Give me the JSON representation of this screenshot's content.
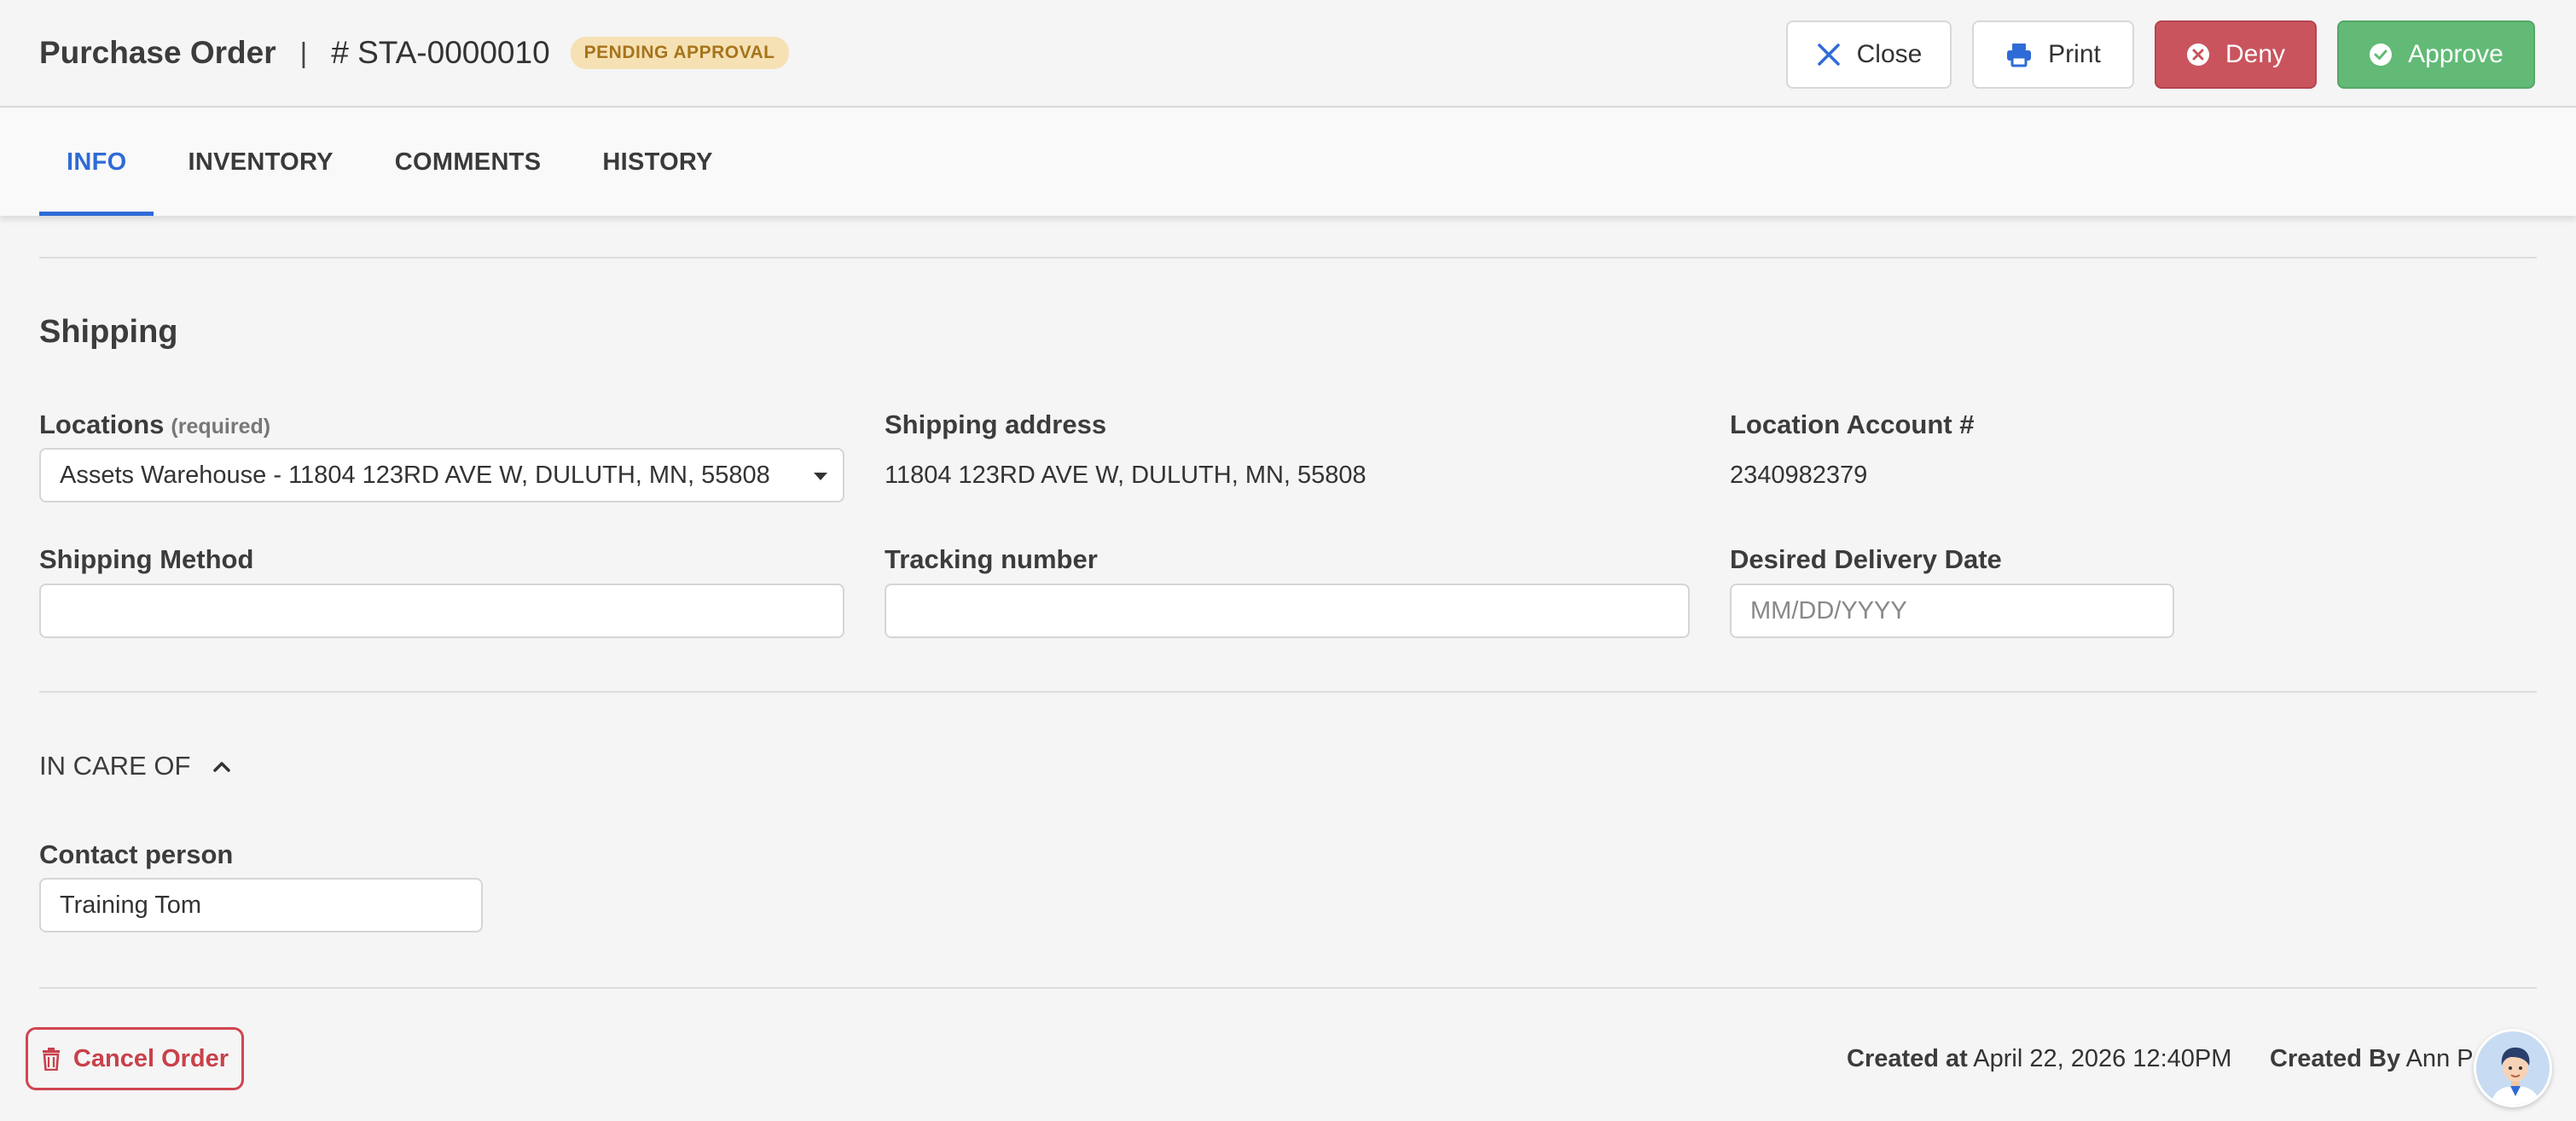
{
  "header": {
    "title": "Purchase Order",
    "separator": "|",
    "order_number": "# STA-0000010",
    "status_badge": "PENDING APPROVAL",
    "buttons": {
      "close": "Close",
      "print": "Print",
      "deny": "Deny",
      "approve": "Approve"
    }
  },
  "tabs": [
    {
      "label": "INFO",
      "active": true
    },
    {
      "label": "INVENTORY",
      "active": false
    },
    {
      "label": "COMMENTS",
      "active": false
    },
    {
      "label": "HISTORY",
      "active": false
    }
  ],
  "shipping": {
    "title": "Shipping",
    "locations_label": "Locations",
    "locations_required": "(required)",
    "locations_value": "Assets Warehouse - 11804 123RD AVE W, DULUTH, MN, 55808",
    "shipping_address_label": "Shipping address",
    "shipping_address_value": "11804 123RD AVE W, DULUTH, MN, 55808",
    "location_account_label": "Location Account #",
    "location_account_value": "2340982379",
    "shipping_method_label": "Shipping Method",
    "shipping_method_value": "",
    "tracking_number_label": "Tracking number",
    "tracking_number_value": "",
    "desired_delivery_label": "Desired Delivery Date",
    "desired_delivery_placeholder": "MM/DD/YYYY"
  },
  "care_of": {
    "title": "IN CARE OF",
    "contact_label": "Contact person",
    "contact_value": "Training Tom"
  },
  "footer": {
    "cancel_label": "Cancel Order",
    "created_at_label": "Created at",
    "created_at_value": "April 22, 2026 12:40PM",
    "created_by_label": "Created By",
    "created_by_value": "Ann P"
  },
  "colors": {
    "accent": "#2f6bd6",
    "deny": "#c9545e",
    "approve": "#62ba76",
    "badge_bg": "#f6e1b4",
    "badge_text": "#a6741b",
    "cancel": "#c8414b"
  },
  "icons": {
    "close": "close-icon",
    "print": "printer-icon",
    "deny": "x-circle-icon",
    "approve": "check-circle-icon",
    "collapse": "chevron-up-icon",
    "cancel": "trash-icon",
    "dropdown": "caret-down-icon"
  }
}
